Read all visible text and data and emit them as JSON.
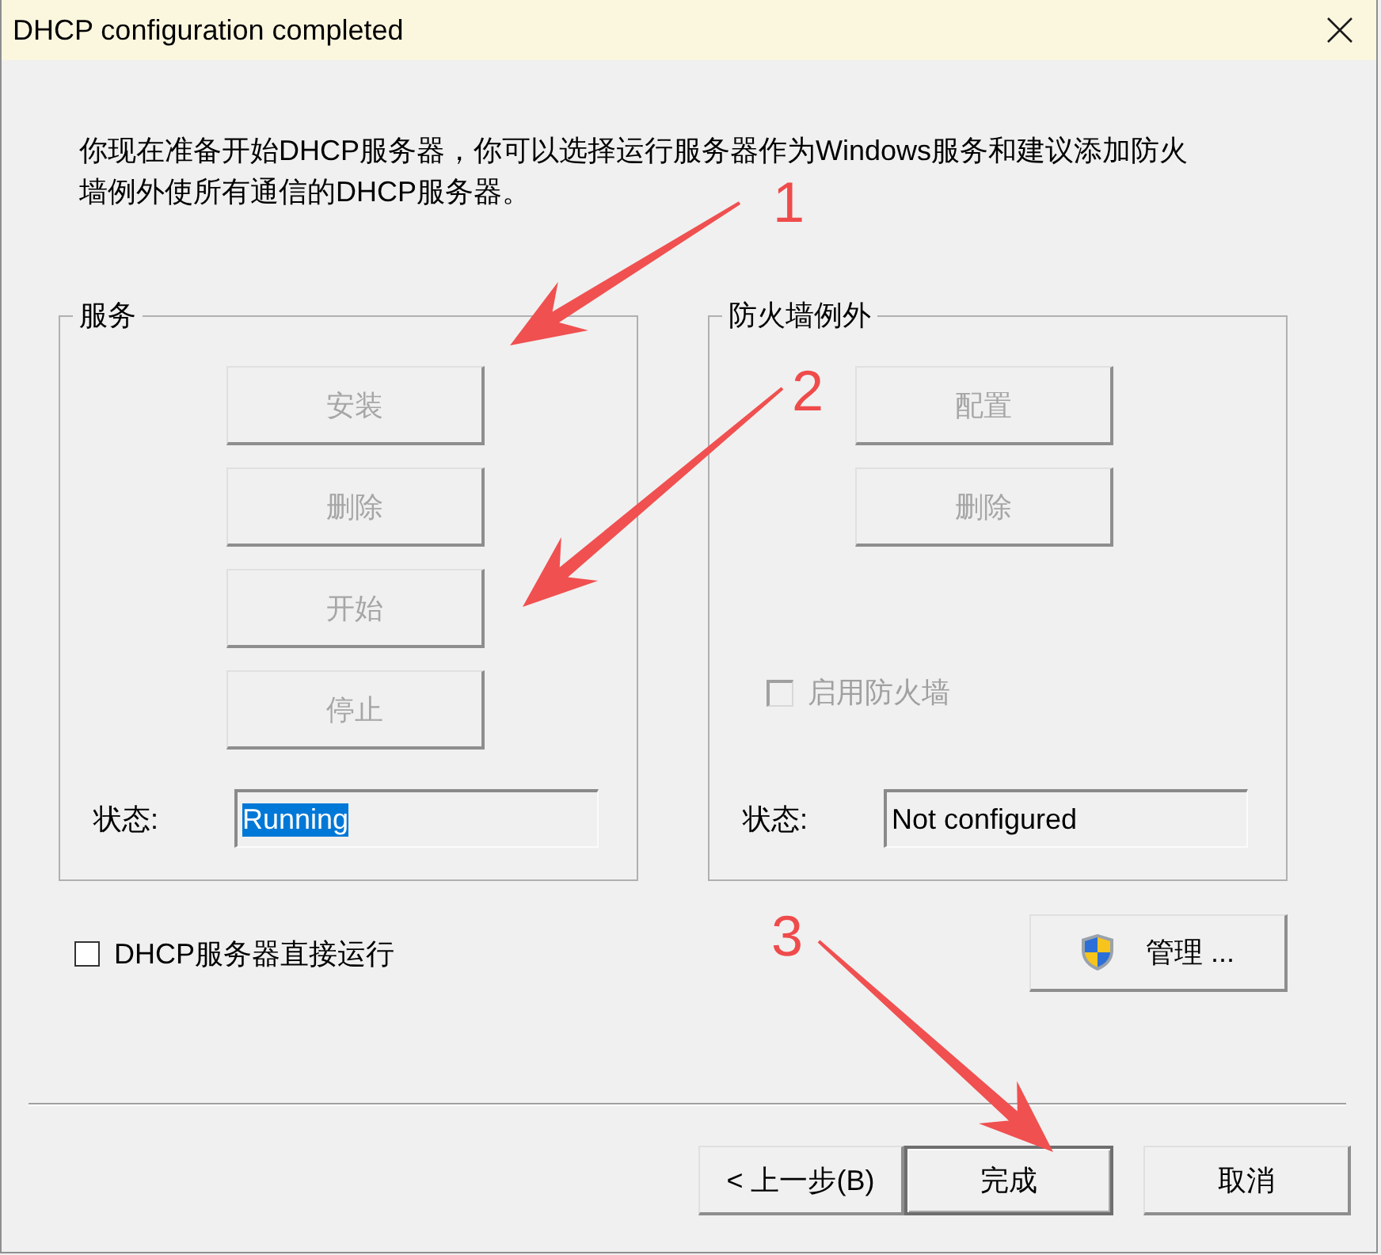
{
  "window": {
    "title": "DHCP configuration completed"
  },
  "description_lines": [
    "你现在准备开始DHCP服务器，你可以选择运行服务器作为Windows服务和建议添加防火",
    "墙例外使所有通信的DHCP服务器。"
  ],
  "groups": [
    {
      "title": "服务",
      "buttons": [
        {
          "label": "安装",
          "disabled": true
        },
        {
          "label": "删除",
          "disabled": true
        },
        {
          "label": "开始",
          "disabled": true
        },
        {
          "label": "停止",
          "disabled": true
        }
      ],
      "status": {
        "label": "状态:",
        "value": "Running",
        "highlighted": true
      }
    },
    {
      "title": "防火墙例外",
      "buttons": [
        {
          "label": "配置",
          "disabled": true
        },
        {
          "label": "删除",
          "disabled": true
        }
      ],
      "checkbox": {
        "label": "启用防火墙",
        "checked": false,
        "disabled": true
      },
      "status": {
        "label": "状态:",
        "value": "Not configured",
        "highlighted": false
      }
    }
  ],
  "run_directly": {
    "label": "DHCP服务器直接运行",
    "checked": false
  },
  "manage_button": {
    "label": "管理 ..."
  },
  "nav_buttons": [
    {
      "label": "< 上一步(B)",
      "default": false
    },
    {
      "label": "完成",
      "default": true
    },
    {
      "label": "取消",
      "default": false
    }
  ],
  "annotations": [
    {
      "number": "1"
    },
    {
      "number": "2"
    },
    {
      "number": "3"
    }
  ]
}
